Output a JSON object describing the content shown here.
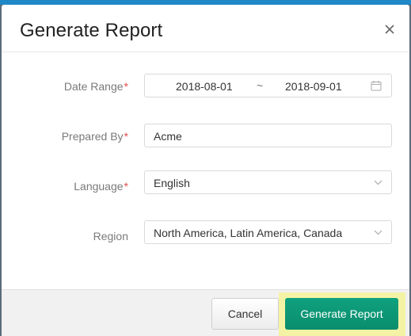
{
  "dialog": {
    "title": "Generate Report",
    "close_icon": "close-icon"
  },
  "form": {
    "date_range": {
      "label": "Date Range",
      "required_mark": "*",
      "start": "2018-08-01",
      "separator": "~",
      "end": "2018-09-01",
      "icon": "calendar-icon"
    },
    "prepared_by": {
      "label": "Prepared By",
      "required_mark": "*",
      "value": "Acme"
    },
    "language": {
      "label": "Language",
      "required_mark": "*",
      "value": "English",
      "icon": "chevron-down-icon"
    },
    "region": {
      "label": "Region",
      "value": "North America, Latin America, Canada",
      "icon": "chevron-down-icon"
    }
  },
  "footer": {
    "cancel_label": "Cancel",
    "generate_label": "Generate Report",
    "highlight_color": "#f4f3a5",
    "accent_color": "#0a8d6d"
  }
}
